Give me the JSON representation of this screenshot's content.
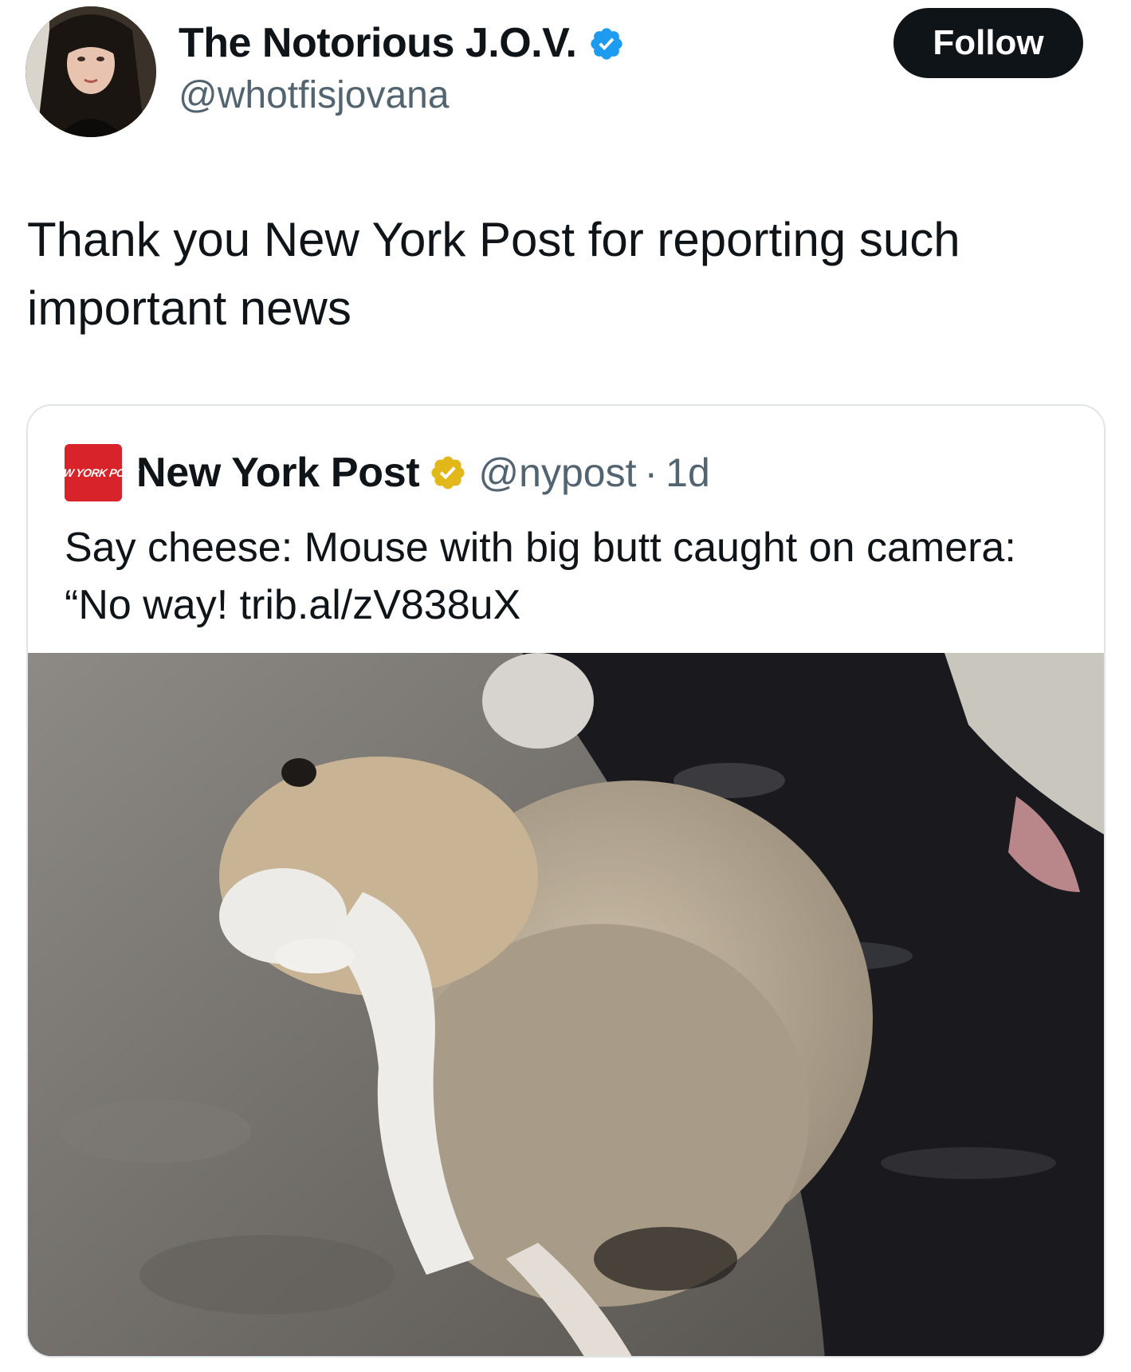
{
  "tweet": {
    "author": {
      "display_name": "The Notorious J.O.V.",
      "handle": "@whotfisjovana",
      "verified_icon": "verified-badge-blue",
      "avatar_icon": "profile-photo"
    },
    "follow_label": "Follow",
    "text": "Thank you New York Post for reporting such important news"
  },
  "quote": {
    "logo_text": "New York Post",
    "author_name": "New York Post",
    "verified_icon": "verified-badge-gold",
    "handle": "@nypost",
    "separator": "·",
    "time": "1d",
    "text": "Say cheese: Mouse with big butt caught on camera: “No way! trib.al/zV838uX",
    "media_icon": "mouse-photo"
  },
  "colors": {
    "text_primary": "#0f1419",
    "text_secondary": "#536471",
    "follow_bg": "#0f1419",
    "verified_blue": "#1d9bf0",
    "verified_gold": "#e2b719",
    "nyp_red": "#d8232a",
    "card_border": "#e1e5e9"
  }
}
